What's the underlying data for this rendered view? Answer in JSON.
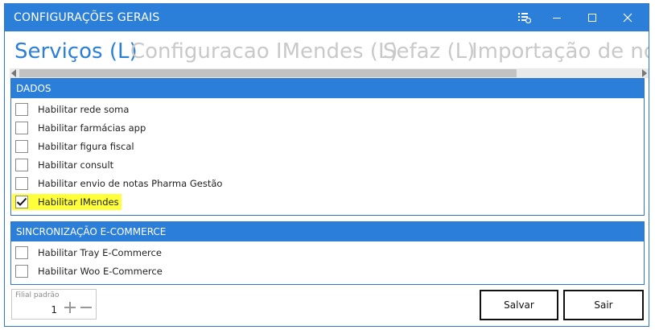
{
  "window": {
    "title": "CONFIGURAÇÕES GERAIS",
    "controls": [
      "settings-list-icon",
      "minimize-icon",
      "maximize-icon",
      "close-icon"
    ]
  },
  "tabs": [
    {
      "label": "Serviços (L)",
      "active": true
    },
    {
      "label": "Configuracao IMendes (L)",
      "active": false
    },
    {
      "label": "Sefaz (L)",
      "active": false
    },
    {
      "label": "Importação de not",
      "active": false
    }
  ],
  "groups": {
    "dados": {
      "header": "DADOS",
      "items": [
        {
          "label": "Habilitar rede soma",
          "checked": false
        },
        {
          "label": "Habilitar farmácias app",
          "checked": false
        },
        {
          "label": "Habilitar figura fiscal",
          "checked": false
        },
        {
          "label": "Habilitar consult",
          "checked": false
        },
        {
          "label": "Habilitar envio de notas Pharma Gestão",
          "checked": false
        },
        {
          "label": "Habilitar IMendes",
          "checked": true,
          "highlighted": true
        }
      ]
    },
    "ecommerce": {
      "header": "SINCRONIZAÇÃO E-COMMERCE",
      "items": [
        {
          "label": "Habilitar Tray E-Commerce",
          "checked": false
        },
        {
          "label": "Habilitar Woo E-Commerce",
          "checked": false
        }
      ]
    }
  },
  "footer": {
    "filial_label": "Filial padrão",
    "filial_value": "1",
    "save_label": "Salvar",
    "exit_label": "Sair"
  },
  "colors": {
    "accent": "#2b7fd8",
    "inactive_tab": "#c9c9c9",
    "highlight": "#ffff3a"
  }
}
